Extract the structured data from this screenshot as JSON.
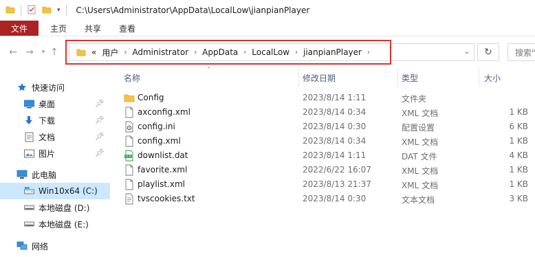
{
  "window": {
    "title_path": "C:\\Users\\Administrator\\AppData\\LocalLow\\jianpianPlayer"
  },
  "ribbon": {
    "tabs": [
      {
        "label": "文件",
        "active": true
      },
      {
        "label": "主页"
      },
      {
        "label": "共享"
      },
      {
        "label": "查看"
      }
    ]
  },
  "address": {
    "overflow": "«",
    "crumbs": [
      "用户",
      "Administrator",
      "AppData",
      "LocalLow",
      "jianpianPlayer"
    ],
    "search_placeholder": "搜索\""
  },
  "sidebar": {
    "items": [
      {
        "label": "快速访问",
        "icon": "star-icon",
        "pinned": false
      },
      {
        "label": "桌面",
        "icon": "desktop-icon",
        "pinned": true
      },
      {
        "label": "下载",
        "icon": "download-icon",
        "pinned": true
      },
      {
        "label": "文档",
        "icon": "documents-icon",
        "pinned": true
      },
      {
        "label": "图片",
        "icon": "pictures-icon",
        "pinned": true
      },
      {
        "label": "此电脑",
        "icon": "computer-icon",
        "pinned": false
      },
      {
        "label": "Win10x64  (C:)",
        "icon": "drive-c-icon",
        "pinned": false,
        "selected": true
      },
      {
        "label": "本地磁盘 (D:)",
        "icon": "drive-icon",
        "pinned": false
      },
      {
        "label": "本地磁盘 (E:)",
        "icon": "drive-icon",
        "pinned": false
      },
      {
        "label": "网络",
        "icon": "network-icon",
        "pinned": false
      }
    ]
  },
  "list": {
    "columns": {
      "name": "名称",
      "date": "修改日期",
      "type": "类型",
      "size": "大小"
    },
    "rows": [
      {
        "name": "Config",
        "date": "2023/8/14 1:11",
        "type": "文件夹",
        "size": "",
        "icon": "folder-icon"
      },
      {
        "name": "axconfig.xml",
        "date": "2023/8/14 0:34",
        "type": "XML 文档",
        "size": "1 KB",
        "icon": "file-icon"
      },
      {
        "name": "config.ini",
        "date": "2023/8/14 0:30",
        "type": "配置设置",
        "size": "6 KB",
        "icon": "settings-file-icon"
      },
      {
        "name": "config.xml",
        "date": "2023/8/14 0:34",
        "type": "XML 文档",
        "size": "1 KB",
        "icon": "file-icon"
      },
      {
        "name": "downlist.dat",
        "date": "2023/8/14 1:11",
        "type": "DAT 文件",
        "size": "4 KB",
        "icon": "dat-file-icon"
      },
      {
        "name": "favorite.xml",
        "date": "2022/6/22 16:07",
        "type": "XML 文档",
        "size": "1 KB",
        "icon": "file-icon"
      },
      {
        "name": "playlist.xml",
        "date": "2023/8/13 21:37",
        "type": "XML 文档",
        "size": "1 KB",
        "icon": "file-icon"
      },
      {
        "name": "tvscookies.txt",
        "date": "2023/8/14 0:30",
        "type": "文本文档",
        "size": "3 KB",
        "icon": "text-file-icon"
      }
    ]
  },
  "colors": {
    "file_tab": "#ab2322",
    "highlight_box": "#e03030",
    "selected_bg": "#cce8ff",
    "folder": "#f5c342"
  }
}
